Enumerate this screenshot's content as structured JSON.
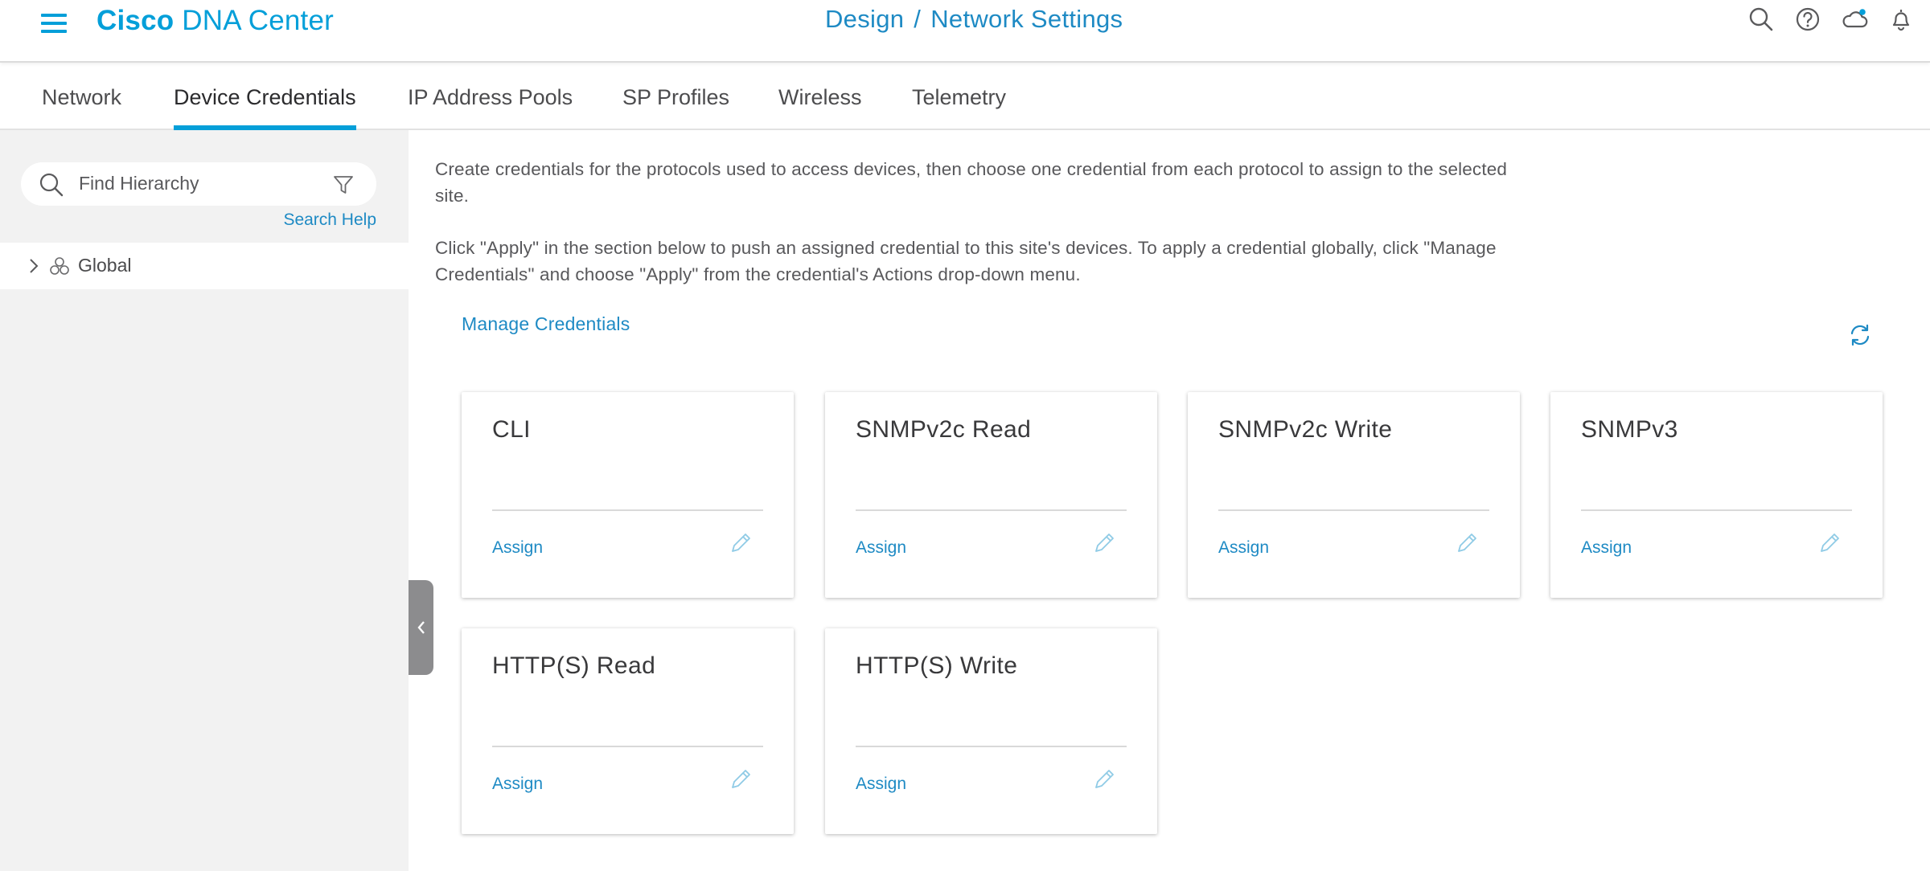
{
  "header": {
    "brand_bold": "Cisco",
    "brand_rest": " DNA Center",
    "breadcrumb": [
      "Design",
      "Network Settings"
    ],
    "breadcrumb_separator": "/",
    "icons": [
      "search-icon",
      "help-icon",
      "cloud-icon",
      "bell-icon"
    ]
  },
  "tabs": [
    {
      "label": "Network",
      "active": false
    },
    {
      "label": "Device Credentials",
      "active": true
    },
    {
      "label": "IP Address Pools",
      "active": false
    },
    {
      "label": "SP Profiles",
      "active": false
    },
    {
      "label": "Wireless",
      "active": false
    },
    {
      "label": "Telemetry",
      "active": false
    }
  ],
  "sidebar": {
    "search_placeholder": "Find Hierarchy",
    "search_help": "Search Help",
    "tree": [
      {
        "label": "Global",
        "expanded": false
      }
    ]
  },
  "main": {
    "description_1": "Create credentials for the protocols used to access devices, then choose one credential from each protocol to assign to the selected site.",
    "description_2": "Click \"Apply\" in the section below to push an assigned credential to this site's devices. To apply a credential globally, click \"Manage Credentials\" and choose \"Apply\" from the credential's Actions drop-down menu.",
    "manage_link": "Manage Credentials",
    "cards": [
      {
        "title": "CLI",
        "action": "Assign"
      },
      {
        "title": "SNMPv2c Read",
        "action": "Assign"
      },
      {
        "title": "SNMPv2c Write",
        "action": "Assign"
      },
      {
        "title": "SNMPv3",
        "action": "Assign"
      },
      {
        "title": "HTTP(S) Read",
        "action": "Assign"
      },
      {
        "title": "HTTP(S) Write",
        "action": "Assign"
      }
    ]
  },
  "colors": {
    "accent": "#049fd9",
    "link": "#1e8ac4",
    "sidebar_bg": "#f2f2f2"
  }
}
